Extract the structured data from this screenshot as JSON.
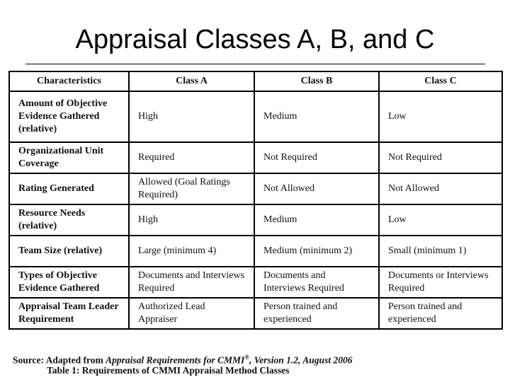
{
  "title": "Appraisal Classes A, B, and C",
  "table": {
    "headers": [
      "Characteristics",
      "Class A",
      "Class B",
      "Class C"
    ],
    "rows": [
      {
        "characteristic": "Amount of Objective Evidence Gathered (relative)",
        "class_a": "High",
        "class_b": "Medium",
        "class_c": "Low"
      },
      {
        "characteristic": "Organizational Unit Coverage",
        "class_a": "Required",
        "class_b": "Not Required",
        "class_c": "Not Required"
      },
      {
        "characteristic": "Rating Generated",
        "class_a": "Allowed (Goal Ratings Required)",
        "class_b": "Not Allowed",
        "class_c": "Not Allowed"
      },
      {
        "characteristic": "Resource Needs (relative)",
        "class_a": "High",
        "class_b": "Medium",
        "class_c": "Low"
      },
      {
        "characteristic": "Team Size (relative)",
        "class_a": "Large (minimum 4)",
        "class_b": "Medium (minimum 2)",
        "class_c": "Small (minimum 1)"
      },
      {
        "characteristic": "Types of Objective Evidence Gathered",
        "class_a": "Documents and Interviews Required",
        "class_b": "Documents and Interviews Required",
        "class_c": "Documents or Interviews Required"
      },
      {
        "characteristic": "Appraisal Team Leader Requirement",
        "class_a": "Authorized Lead Appraiser",
        "class_b": "Person trained and experienced",
        "class_c": "Person trained and experienced"
      }
    ]
  },
  "source": {
    "prefix": "Source: Adapted from ",
    "work": "Appraisal Requirements for CMMI",
    "mark": "®",
    "suffix": ", Version 1.2, August 2006"
  },
  "caption": "Table 1: Requirements of CMMI Appraisal Method Classes"
}
